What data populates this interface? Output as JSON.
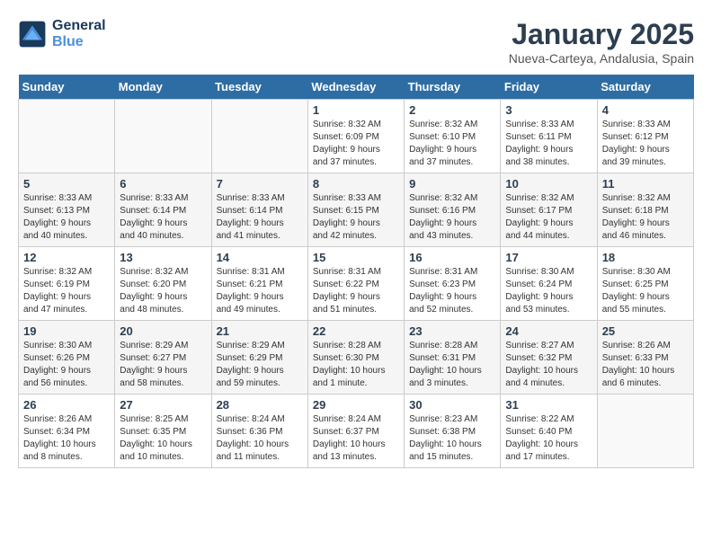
{
  "header": {
    "logo_line1": "General",
    "logo_line2": "Blue",
    "title": "January 2025",
    "subtitle": "Nueva-Carteya, Andalusia, Spain"
  },
  "days_of_week": [
    "Sunday",
    "Monday",
    "Tuesday",
    "Wednesday",
    "Thursday",
    "Friday",
    "Saturday"
  ],
  "weeks": [
    [
      {
        "day": "",
        "info": ""
      },
      {
        "day": "",
        "info": ""
      },
      {
        "day": "",
        "info": ""
      },
      {
        "day": "1",
        "info": "Sunrise: 8:32 AM\nSunset: 6:09 PM\nDaylight: 9 hours\nand 37 minutes."
      },
      {
        "day": "2",
        "info": "Sunrise: 8:32 AM\nSunset: 6:10 PM\nDaylight: 9 hours\nand 37 minutes."
      },
      {
        "day": "3",
        "info": "Sunrise: 8:33 AM\nSunset: 6:11 PM\nDaylight: 9 hours\nand 38 minutes."
      },
      {
        "day": "4",
        "info": "Sunrise: 8:33 AM\nSunset: 6:12 PM\nDaylight: 9 hours\nand 39 minutes."
      }
    ],
    [
      {
        "day": "5",
        "info": "Sunrise: 8:33 AM\nSunset: 6:13 PM\nDaylight: 9 hours\nand 40 minutes."
      },
      {
        "day": "6",
        "info": "Sunrise: 8:33 AM\nSunset: 6:14 PM\nDaylight: 9 hours\nand 40 minutes."
      },
      {
        "day": "7",
        "info": "Sunrise: 8:33 AM\nSunset: 6:14 PM\nDaylight: 9 hours\nand 41 minutes."
      },
      {
        "day": "8",
        "info": "Sunrise: 8:33 AM\nSunset: 6:15 PM\nDaylight: 9 hours\nand 42 minutes."
      },
      {
        "day": "9",
        "info": "Sunrise: 8:32 AM\nSunset: 6:16 PM\nDaylight: 9 hours\nand 43 minutes."
      },
      {
        "day": "10",
        "info": "Sunrise: 8:32 AM\nSunset: 6:17 PM\nDaylight: 9 hours\nand 44 minutes."
      },
      {
        "day": "11",
        "info": "Sunrise: 8:32 AM\nSunset: 6:18 PM\nDaylight: 9 hours\nand 46 minutes."
      }
    ],
    [
      {
        "day": "12",
        "info": "Sunrise: 8:32 AM\nSunset: 6:19 PM\nDaylight: 9 hours\nand 47 minutes."
      },
      {
        "day": "13",
        "info": "Sunrise: 8:32 AM\nSunset: 6:20 PM\nDaylight: 9 hours\nand 48 minutes."
      },
      {
        "day": "14",
        "info": "Sunrise: 8:31 AM\nSunset: 6:21 PM\nDaylight: 9 hours\nand 49 minutes."
      },
      {
        "day": "15",
        "info": "Sunrise: 8:31 AM\nSunset: 6:22 PM\nDaylight: 9 hours\nand 51 minutes."
      },
      {
        "day": "16",
        "info": "Sunrise: 8:31 AM\nSunset: 6:23 PM\nDaylight: 9 hours\nand 52 minutes."
      },
      {
        "day": "17",
        "info": "Sunrise: 8:30 AM\nSunset: 6:24 PM\nDaylight: 9 hours\nand 53 minutes."
      },
      {
        "day": "18",
        "info": "Sunrise: 8:30 AM\nSunset: 6:25 PM\nDaylight: 9 hours\nand 55 minutes."
      }
    ],
    [
      {
        "day": "19",
        "info": "Sunrise: 8:30 AM\nSunset: 6:26 PM\nDaylight: 9 hours\nand 56 minutes."
      },
      {
        "day": "20",
        "info": "Sunrise: 8:29 AM\nSunset: 6:27 PM\nDaylight: 9 hours\nand 58 minutes."
      },
      {
        "day": "21",
        "info": "Sunrise: 8:29 AM\nSunset: 6:29 PM\nDaylight: 9 hours\nand 59 minutes."
      },
      {
        "day": "22",
        "info": "Sunrise: 8:28 AM\nSunset: 6:30 PM\nDaylight: 10 hours\nand 1 minute."
      },
      {
        "day": "23",
        "info": "Sunrise: 8:28 AM\nSunset: 6:31 PM\nDaylight: 10 hours\nand 3 minutes."
      },
      {
        "day": "24",
        "info": "Sunrise: 8:27 AM\nSunset: 6:32 PM\nDaylight: 10 hours\nand 4 minutes."
      },
      {
        "day": "25",
        "info": "Sunrise: 8:26 AM\nSunset: 6:33 PM\nDaylight: 10 hours\nand 6 minutes."
      }
    ],
    [
      {
        "day": "26",
        "info": "Sunrise: 8:26 AM\nSunset: 6:34 PM\nDaylight: 10 hours\nand 8 minutes."
      },
      {
        "day": "27",
        "info": "Sunrise: 8:25 AM\nSunset: 6:35 PM\nDaylight: 10 hours\nand 10 minutes."
      },
      {
        "day": "28",
        "info": "Sunrise: 8:24 AM\nSunset: 6:36 PM\nDaylight: 10 hours\nand 11 minutes."
      },
      {
        "day": "29",
        "info": "Sunrise: 8:24 AM\nSunset: 6:37 PM\nDaylight: 10 hours\nand 13 minutes."
      },
      {
        "day": "30",
        "info": "Sunrise: 8:23 AM\nSunset: 6:38 PM\nDaylight: 10 hours\nand 15 minutes."
      },
      {
        "day": "31",
        "info": "Sunrise: 8:22 AM\nSunset: 6:40 PM\nDaylight: 10 hours\nand 17 minutes."
      },
      {
        "day": "",
        "info": ""
      }
    ]
  ]
}
